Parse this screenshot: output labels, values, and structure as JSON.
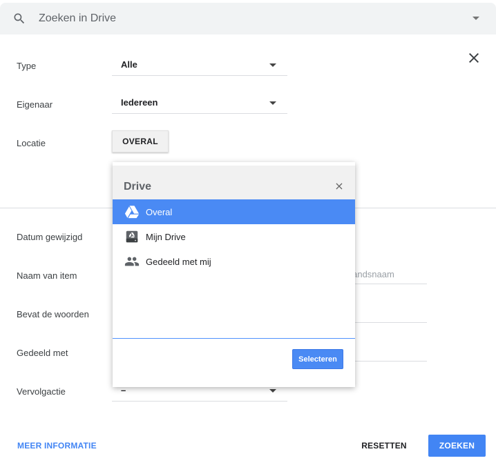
{
  "search": {
    "placeholder": "Zoeken in Drive",
    "icon": "search-icon"
  },
  "form": {
    "type": {
      "label": "Type",
      "value": "Alle"
    },
    "owner": {
      "label": "Eigenaar",
      "value": "Iedereen"
    },
    "location": {
      "label": "Locatie",
      "button_label": "OVERAL"
    },
    "date_modified": {
      "label": "Datum gewijzigd"
    },
    "item_name": {
      "label": "Naam van item",
      "placeholder": "standsnaam"
    },
    "contains_words": {
      "label": "Bevat de woorden"
    },
    "shared_with": {
      "label": "Gedeeld met"
    },
    "follow_up": {
      "label": "Vervolgactie",
      "value": "–"
    }
  },
  "popup": {
    "title": "Drive",
    "close_symbol": "×",
    "items": [
      {
        "label": "Overal",
        "icon": "drive-logo-icon",
        "selected": true
      },
      {
        "label": "Mijn Drive",
        "icon": "my-drive-icon",
        "selected": false
      },
      {
        "label": "Gedeeld met mij",
        "icon": "people-icon",
        "selected": false
      }
    ],
    "select_label": "Selecteren"
  },
  "footer": {
    "more_info": "MEER INFORMATIE",
    "reset": "RESETTEN",
    "search": "ZOEKEN"
  },
  "colors": {
    "accent": "#4285f4",
    "selected_row": "#4a8af4",
    "search_bar_bg": "#f1f3f4"
  }
}
